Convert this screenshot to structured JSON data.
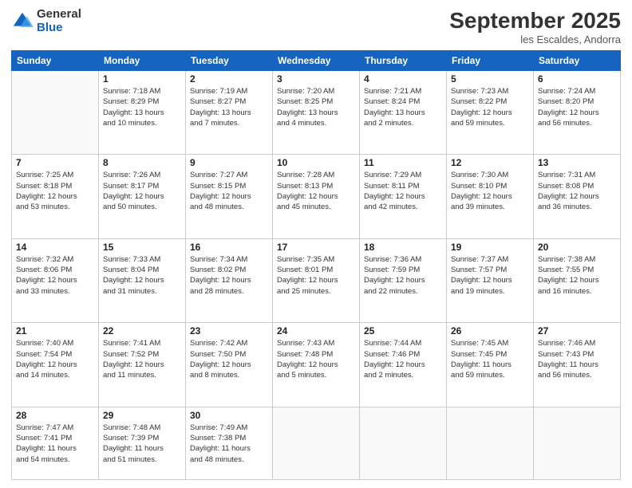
{
  "logo": {
    "general": "General",
    "blue": "Blue"
  },
  "header": {
    "title": "September 2025",
    "subtitle": "les Escaldes, Andorra"
  },
  "days_of_week": [
    "Sunday",
    "Monday",
    "Tuesday",
    "Wednesday",
    "Thursday",
    "Friday",
    "Saturday"
  ],
  "weeks": [
    [
      {
        "day": "",
        "info": ""
      },
      {
        "day": "1",
        "info": "Sunrise: 7:18 AM\nSunset: 8:29 PM\nDaylight: 13 hours\nand 10 minutes."
      },
      {
        "day": "2",
        "info": "Sunrise: 7:19 AM\nSunset: 8:27 PM\nDaylight: 13 hours\nand 7 minutes."
      },
      {
        "day": "3",
        "info": "Sunrise: 7:20 AM\nSunset: 8:25 PM\nDaylight: 13 hours\nand 4 minutes."
      },
      {
        "day": "4",
        "info": "Sunrise: 7:21 AM\nSunset: 8:24 PM\nDaylight: 13 hours\nand 2 minutes."
      },
      {
        "day": "5",
        "info": "Sunrise: 7:23 AM\nSunset: 8:22 PM\nDaylight: 12 hours\nand 59 minutes."
      },
      {
        "day": "6",
        "info": "Sunrise: 7:24 AM\nSunset: 8:20 PM\nDaylight: 12 hours\nand 56 minutes."
      }
    ],
    [
      {
        "day": "7",
        "info": "Sunrise: 7:25 AM\nSunset: 8:18 PM\nDaylight: 12 hours\nand 53 minutes."
      },
      {
        "day": "8",
        "info": "Sunrise: 7:26 AM\nSunset: 8:17 PM\nDaylight: 12 hours\nand 50 minutes."
      },
      {
        "day": "9",
        "info": "Sunrise: 7:27 AM\nSunset: 8:15 PM\nDaylight: 12 hours\nand 48 minutes."
      },
      {
        "day": "10",
        "info": "Sunrise: 7:28 AM\nSunset: 8:13 PM\nDaylight: 12 hours\nand 45 minutes."
      },
      {
        "day": "11",
        "info": "Sunrise: 7:29 AM\nSunset: 8:11 PM\nDaylight: 12 hours\nand 42 minutes."
      },
      {
        "day": "12",
        "info": "Sunrise: 7:30 AM\nSunset: 8:10 PM\nDaylight: 12 hours\nand 39 minutes."
      },
      {
        "day": "13",
        "info": "Sunrise: 7:31 AM\nSunset: 8:08 PM\nDaylight: 12 hours\nand 36 minutes."
      }
    ],
    [
      {
        "day": "14",
        "info": "Sunrise: 7:32 AM\nSunset: 8:06 PM\nDaylight: 12 hours\nand 33 minutes."
      },
      {
        "day": "15",
        "info": "Sunrise: 7:33 AM\nSunset: 8:04 PM\nDaylight: 12 hours\nand 31 minutes."
      },
      {
        "day": "16",
        "info": "Sunrise: 7:34 AM\nSunset: 8:02 PM\nDaylight: 12 hours\nand 28 minutes."
      },
      {
        "day": "17",
        "info": "Sunrise: 7:35 AM\nSunset: 8:01 PM\nDaylight: 12 hours\nand 25 minutes."
      },
      {
        "day": "18",
        "info": "Sunrise: 7:36 AM\nSunset: 7:59 PM\nDaylight: 12 hours\nand 22 minutes."
      },
      {
        "day": "19",
        "info": "Sunrise: 7:37 AM\nSunset: 7:57 PM\nDaylight: 12 hours\nand 19 minutes."
      },
      {
        "day": "20",
        "info": "Sunrise: 7:38 AM\nSunset: 7:55 PM\nDaylight: 12 hours\nand 16 minutes."
      }
    ],
    [
      {
        "day": "21",
        "info": "Sunrise: 7:40 AM\nSunset: 7:54 PM\nDaylight: 12 hours\nand 14 minutes."
      },
      {
        "day": "22",
        "info": "Sunrise: 7:41 AM\nSunset: 7:52 PM\nDaylight: 12 hours\nand 11 minutes."
      },
      {
        "day": "23",
        "info": "Sunrise: 7:42 AM\nSunset: 7:50 PM\nDaylight: 12 hours\nand 8 minutes."
      },
      {
        "day": "24",
        "info": "Sunrise: 7:43 AM\nSunset: 7:48 PM\nDaylight: 12 hours\nand 5 minutes."
      },
      {
        "day": "25",
        "info": "Sunrise: 7:44 AM\nSunset: 7:46 PM\nDaylight: 12 hours\nand 2 minutes."
      },
      {
        "day": "26",
        "info": "Sunrise: 7:45 AM\nSunset: 7:45 PM\nDaylight: 11 hours\nand 59 minutes."
      },
      {
        "day": "27",
        "info": "Sunrise: 7:46 AM\nSunset: 7:43 PM\nDaylight: 11 hours\nand 56 minutes."
      }
    ],
    [
      {
        "day": "28",
        "info": "Sunrise: 7:47 AM\nSunset: 7:41 PM\nDaylight: 11 hours\nand 54 minutes."
      },
      {
        "day": "29",
        "info": "Sunrise: 7:48 AM\nSunset: 7:39 PM\nDaylight: 11 hours\nand 51 minutes."
      },
      {
        "day": "30",
        "info": "Sunrise: 7:49 AM\nSunset: 7:38 PM\nDaylight: 11 hours\nand 48 minutes."
      },
      {
        "day": "",
        "info": ""
      },
      {
        "day": "",
        "info": ""
      },
      {
        "day": "",
        "info": ""
      },
      {
        "day": "",
        "info": ""
      }
    ]
  ]
}
